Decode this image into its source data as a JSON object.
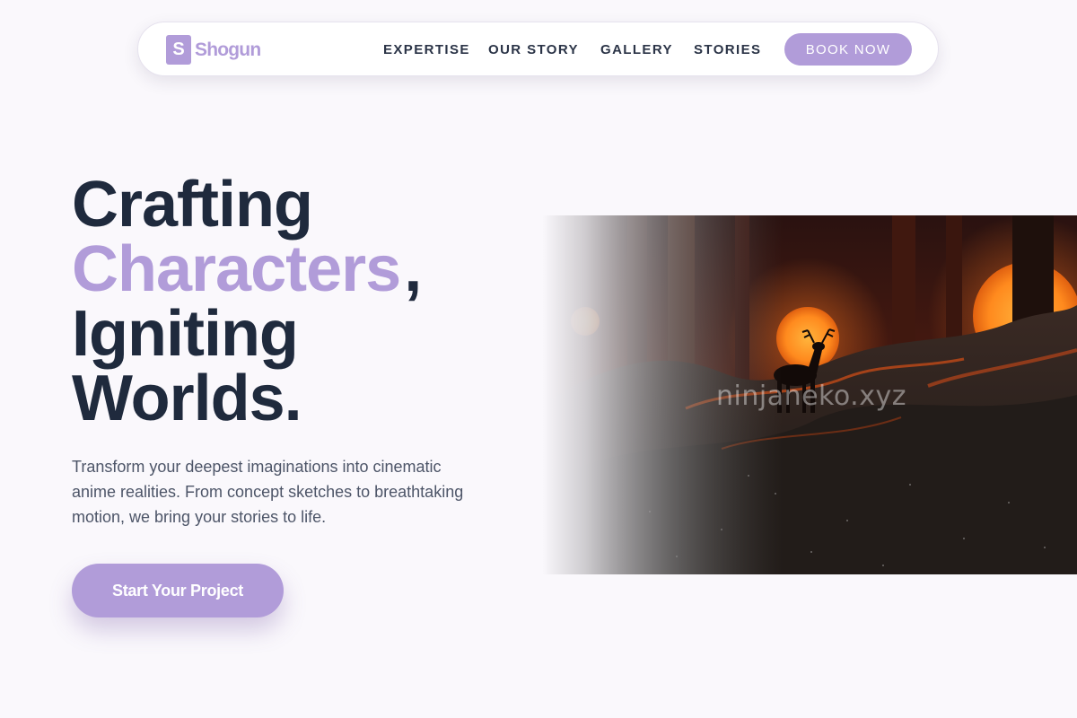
{
  "brand": {
    "logo_letter": "S",
    "name": "Shogun"
  },
  "nav": {
    "links": [
      "EXPERTISE",
      "OUR STORY",
      "GALLERY",
      "STORIES"
    ],
    "cta_label": "BOOK NOW"
  },
  "hero": {
    "title_line1": "Crafting",
    "title_accent": "Characters",
    "title_comma": ",",
    "title_line3": "Igniting",
    "title_line4": "Worlds.",
    "description": "Transform your deepest imaginations into cinematic anime realities. From concept sketches to breathtaking motion, we bring your stories to life.",
    "cta_label": "Start Your Project",
    "image_watermark": "ninjaneko.xyz"
  },
  "colors": {
    "accent": "#b19cd9",
    "heading": "#1f2a3d",
    "body_text": "#4d5568",
    "background": "#faf8fc"
  },
  "icons": [
    "logo-mark-icon",
    "deer-silhouette"
  ]
}
